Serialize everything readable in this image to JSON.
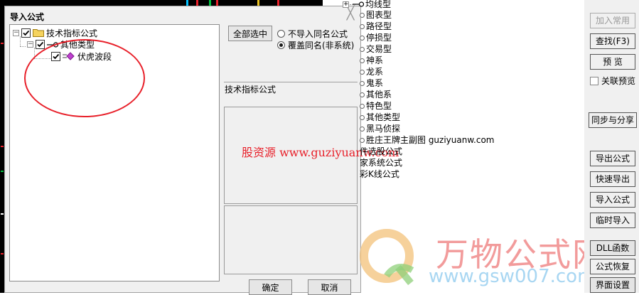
{
  "dialog": {
    "title": "导入公式",
    "close_glyph": "╳",
    "tree": [
      {
        "label": "技术指标公式",
        "checked": true,
        "icon": "folder-icon"
      },
      {
        "label": "其他类型",
        "checked": true,
        "icon": "key-icon"
      },
      {
        "label": "伏虎波段",
        "checked": true,
        "icon": "diamond-icon"
      }
    ],
    "select_all_label": "全部选中",
    "radio_options": [
      {
        "label": "不导入同名公式",
        "selected": false
      },
      {
        "label": "覆盖同名(非系统)",
        "selected": true
      }
    ],
    "section_label": "技术指标公式",
    "watermark": "股资源 www.guziyuanw.com",
    "ok_label": "确定",
    "cancel_label": "取消"
  },
  "right_list": {
    "expander": "+",
    "items": [
      {
        "label": "均线型",
        "marker": "key-icon"
      },
      {
        "label": "图表型",
        "marker": "dot"
      },
      {
        "label": "路径型",
        "marker": "dot"
      },
      {
        "label": "停损型",
        "marker": "dot"
      },
      {
        "label": "交易型",
        "marker": "dot"
      },
      {
        "label": "神系",
        "marker": "dot"
      },
      {
        "label": "龙系",
        "marker": "dot"
      },
      {
        "label": "鬼系",
        "marker": "dot"
      },
      {
        "label": "其他系",
        "marker": "dot"
      },
      {
        "label": "特色型",
        "marker": "dot"
      },
      {
        "label": "其他类型",
        "marker": "dot"
      },
      {
        "label": "黑马侦探",
        "marker": "dot"
      },
      {
        "label": "胜庄王牌主副图 guziyuanw.com",
        "marker": "dot"
      },
      {
        "label": "件选股公式",
        "marker": "none"
      },
      {
        "label": "家系统公式",
        "marker": "none"
      },
      {
        "label": "彩K线公式",
        "marker": "none"
      }
    ]
  },
  "right_buttons": [
    {
      "label": "加入常用",
      "disabled": true
    },
    {
      "label": "查找(F3)",
      "disabled": false
    },
    {
      "label": "预  览",
      "disabled": false
    },
    {
      "label": "关联预览",
      "checkbox": true
    },
    {
      "label": "同步与分享",
      "disabled": false
    },
    {
      "label": "导出公式",
      "disabled": false
    },
    {
      "label": "快速导出",
      "disabled": false
    },
    {
      "label": "导入公式",
      "disabled": false
    },
    {
      "label": "临时导入",
      "disabled": false
    },
    {
      "label": "DLL函数",
      "disabled": false
    },
    {
      "label": "公式恢复",
      "disabled": false
    },
    {
      "label": "界面设置",
      "disabled": false
    }
  ],
  "brand": {
    "name": "万物公式网",
    "url": "www.gsw007.com"
  },
  "colors": {
    "annotation": "#e8202a",
    "watermark": "#e8202a"
  }
}
